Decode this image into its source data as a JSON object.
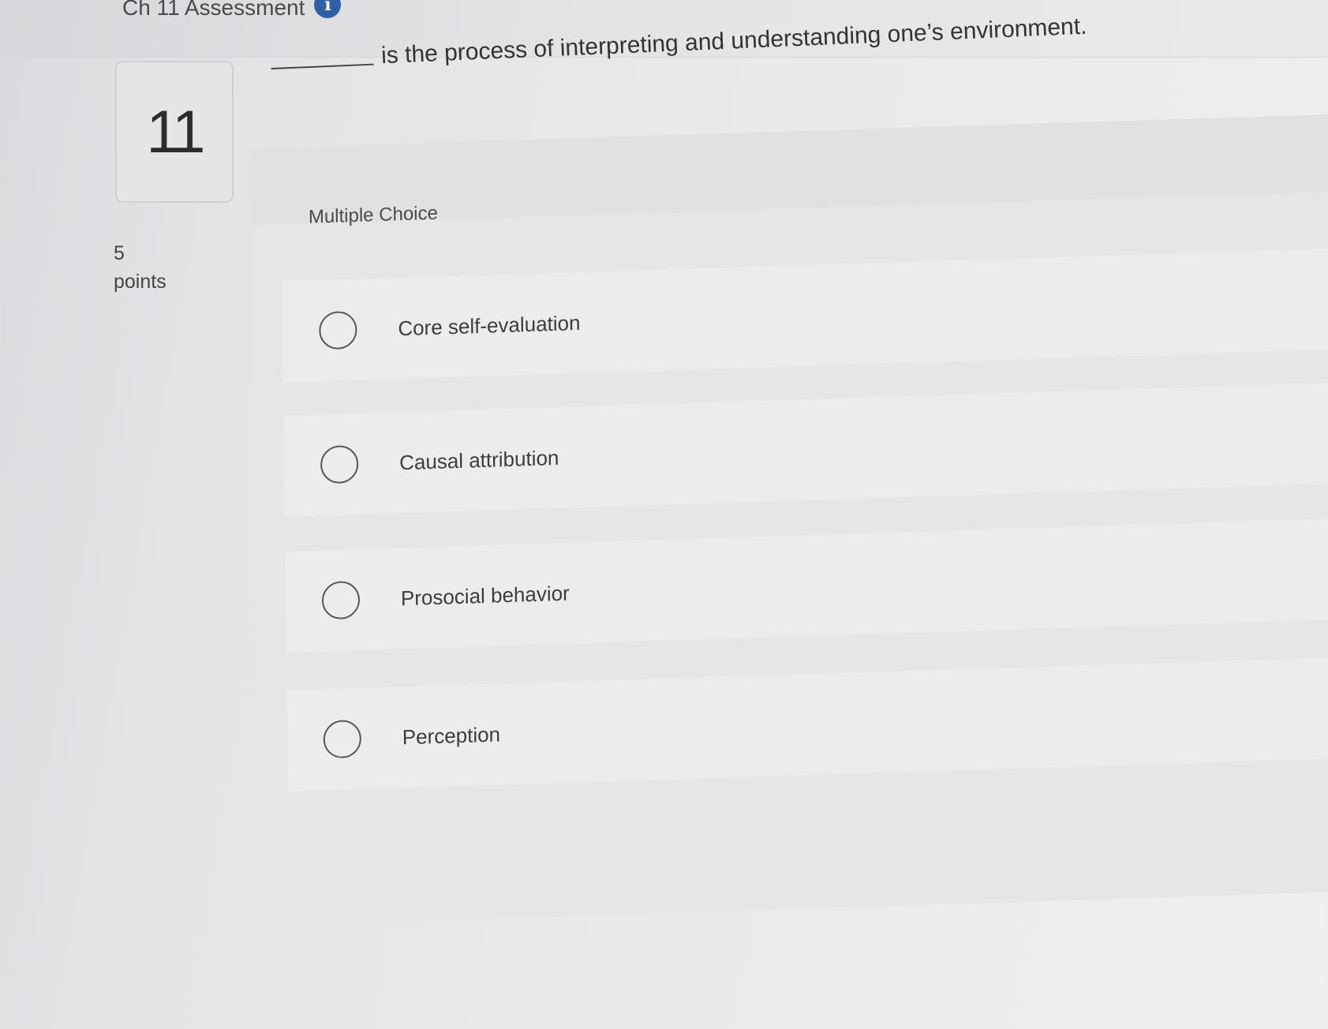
{
  "header": {
    "title": "Ch 11 Assessment",
    "info_icon": "info-icon",
    "info_glyph": "i"
  },
  "question": {
    "number": "11",
    "points_value": "5",
    "points_label": "points",
    "text": "is the process of interpreting and understanding one’s environment."
  },
  "answer_section": {
    "type_label": "Multiple Choice",
    "options": [
      {
        "label": "Core self-evaluation"
      },
      {
        "label": "Causal attribution"
      },
      {
        "label": "Prosocial behavior"
      },
      {
        "label": "Perception"
      }
    ]
  },
  "colors": {
    "info_icon_bg": "#2f5fa8",
    "panel_bg": "#e6e6e7"
  }
}
